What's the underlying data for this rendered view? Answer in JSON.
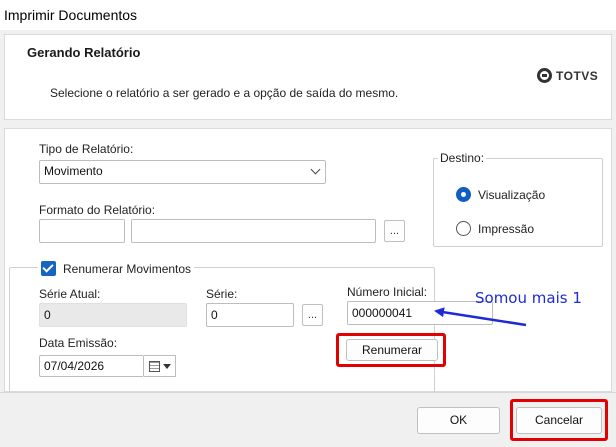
{
  "window": {
    "title": "Imprimir Documentos"
  },
  "header": {
    "title": "Gerando Relatório",
    "subtitle": "Selecione o relatório a ser gerado e a opção de saída do mesmo.",
    "logo_text": "TOTVS"
  },
  "form": {
    "tipo_label": "Tipo de Relatório:",
    "tipo_value": "Movimento",
    "formato_label": "Formato do Relatório:",
    "formato_code": "",
    "formato_desc": "",
    "dots": "...",
    "destino": {
      "title": "Destino:",
      "options": [
        {
          "label": "Visualização",
          "checked": true
        },
        {
          "label": "Impressão",
          "checked": false
        }
      ]
    },
    "renumerar": {
      "label": "Renumerar Movimentos",
      "checked": true,
      "serie_atual_label": "Série Atual:",
      "serie_atual_value": "0",
      "serie_label": "Série:",
      "serie_value": "0",
      "numero_label": "Número Inicial:",
      "numero_value": "000000041",
      "data_label": "Data Emissão:",
      "data_value": "07/04/2026",
      "button": "Renumerar"
    }
  },
  "annotation": {
    "text": "Somou mais 1",
    "color": "#1e2ad6"
  },
  "highlight_color": "#e30000",
  "footer": {
    "ok": "OK",
    "cancel": "Cancelar"
  }
}
